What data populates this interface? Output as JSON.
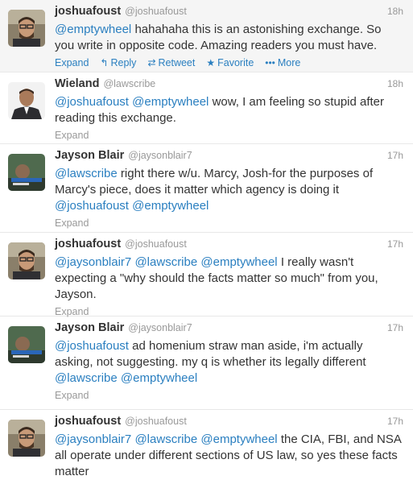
{
  "labels": {
    "expand": "Expand",
    "reply": "Reply",
    "retweet": "Retweet",
    "favorite": "Favorite",
    "more": "More"
  },
  "tweets": [
    {
      "fullname": "joshuafoust",
      "username": "@joshuafoust",
      "time": "18h",
      "mention1": "@emptywheel",
      "text1": "hahahaha this is an astonishing exchange. So you write in opposite code. Amazing readers you must have."
    },
    {
      "fullname": "Wieland",
      "username": "@lawscribe",
      "time": "18h",
      "mention1": "@joshuafoust",
      "mention2": "@emptywheel",
      "text1": "wow, I am feeling so stupid after reading this exchange."
    },
    {
      "fullname": "Jayson Blair",
      "username": "@jaysonblair7",
      "time": "17h",
      "mention1": "@lawscribe",
      "text1": "right there w/u. Marcy, Josh-for the purposes of Marcy's piece, does it matter which agency is doing it",
      "mention2": "@joshuafoust",
      "mention3": "@emptywheel"
    },
    {
      "fullname": "joshuafoust",
      "username": "@joshuafoust",
      "time": "17h",
      "mention1": "@jaysonblair7",
      "mention2": "@lawscribe",
      "mention3": "@emptywheel",
      "text1": "I really wasn't expecting a \"why should the facts matter so much\" from you, Jayson."
    },
    {
      "fullname": "Jayson Blair",
      "username": "@jaysonblair7",
      "time": "17h",
      "mention1": "@joshuafoust",
      "text1": "ad homenium straw man aside, i'm actually asking, not suggesting. my q is whether its legally different",
      "mention2": "@lawscribe",
      "mention3": "@emptywheel"
    },
    {
      "fullname": "joshuafoust",
      "username": "@joshuafoust",
      "time": "17h",
      "mention1": "@jaysonblair7",
      "mention2": "@lawscribe",
      "mention3": "@emptywheel",
      "text1": "the CIA, FBI, and NSA all operate under different sections of US law, so yes these facts matter"
    }
  ]
}
